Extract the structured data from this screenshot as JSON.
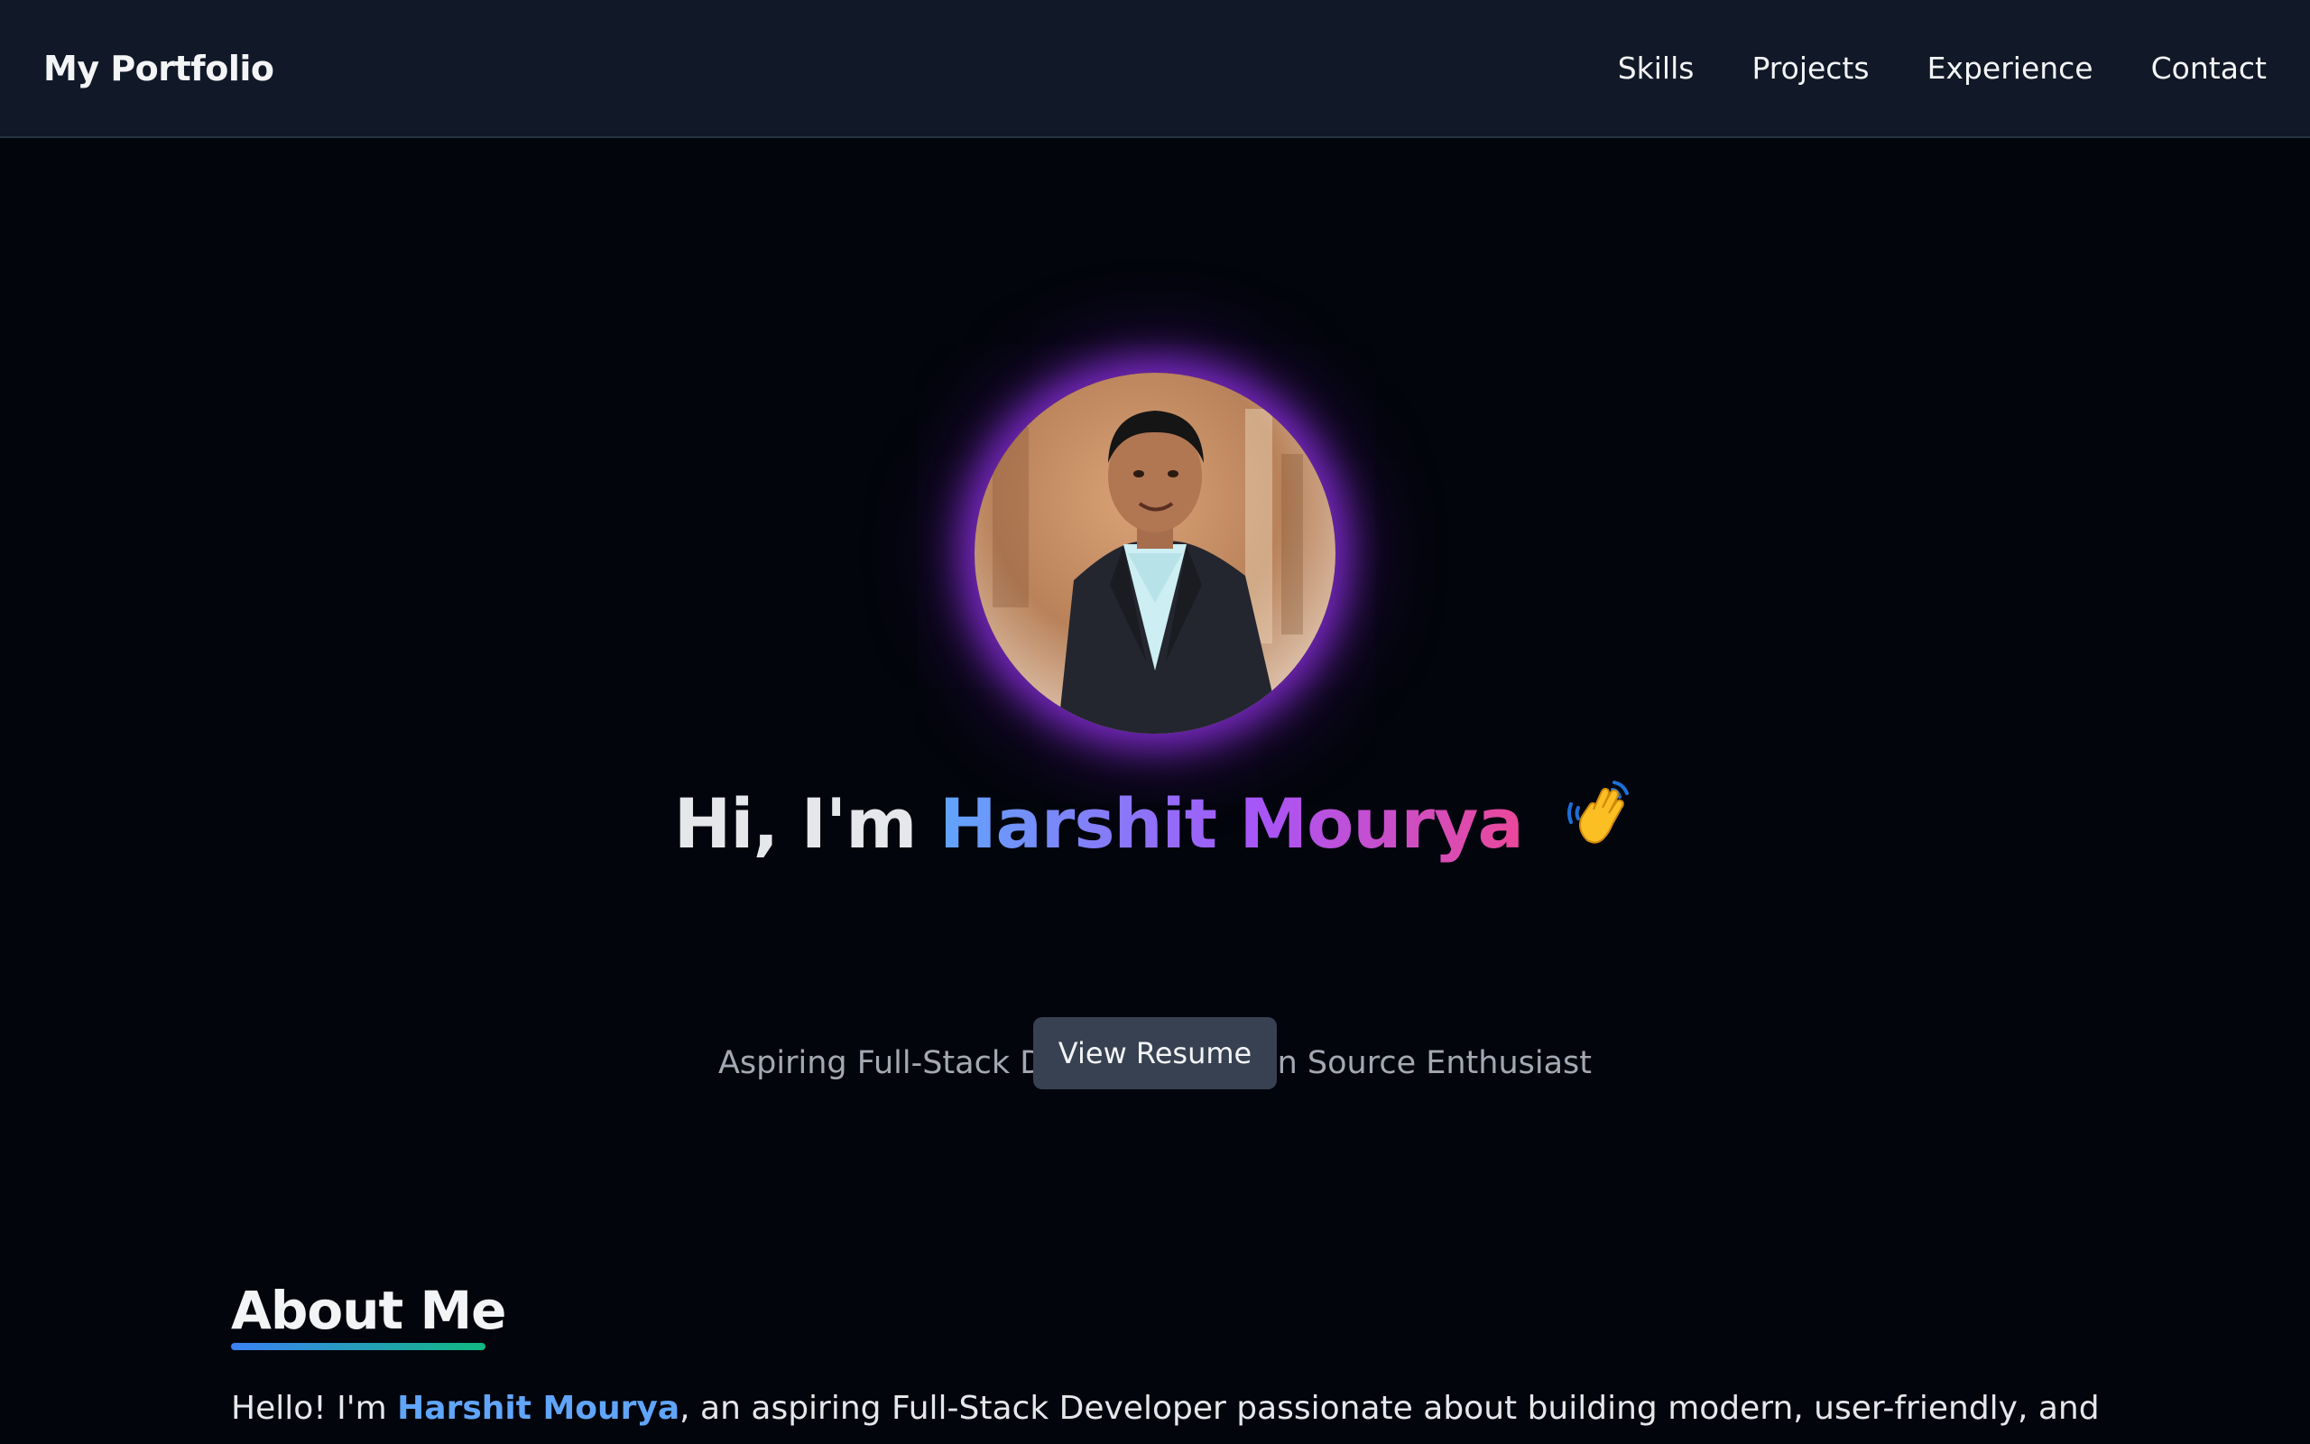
{
  "nav": {
    "brand": "My Portfolio",
    "links": [
      "Skills",
      "Projects",
      "Experience",
      "Contact"
    ]
  },
  "hero": {
    "greeting": "Hi, I'm",
    "name": "Harshit Mourya",
    "wave_icon": "waving-hand-icon",
    "subtitle": "Aspiring Full-Stack Developer | Open Source Enthusiast",
    "resume_button": "View Resume"
  },
  "about": {
    "title": "About Me",
    "intro_prefix": "Hello! I'm ",
    "intro_name": "Harshit Mourya",
    "intro_suffix": ", an aspiring Full-Stack Developer passionate about building modern, user-friendly, and"
  },
  "colors": {
    "background": "#03050c",
    "navbar": "#111827",
    "button": "#374151",
    "accent_blue": "#60a5fa",
    "accent_purple": "#a855f7",
    "accent_pink": "#ec4899",
    "glow": "#9333ea"
  }
}
